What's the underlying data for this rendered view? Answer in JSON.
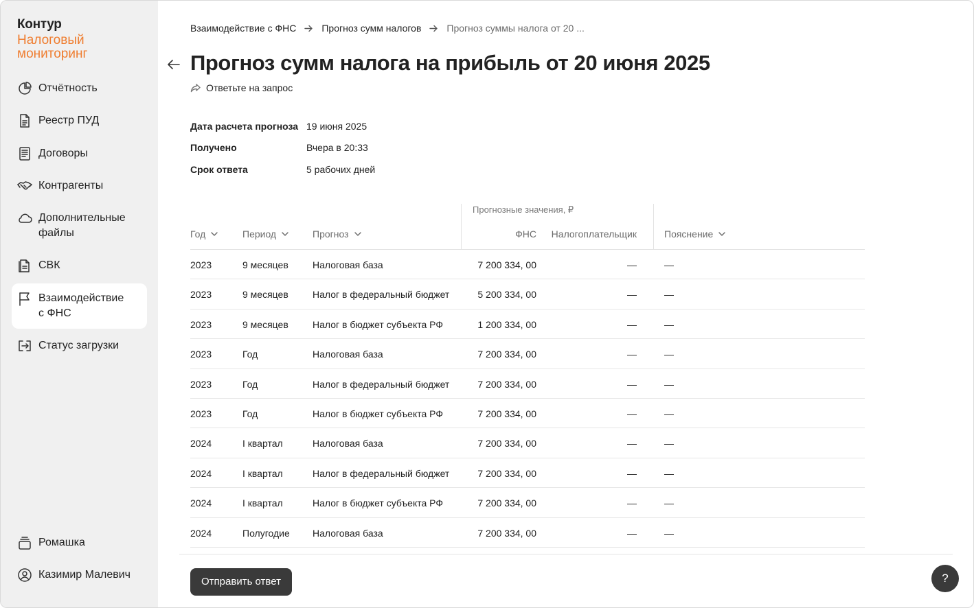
{
  "brand": {
    "name": "Контур",
    "product": "Налоговый\nмониторинг"
  },
  "sidebar": {
    "items": [
      {
        "label": "Отчётность",
        "icon": "pie-chart-icon"
      },
      {
        "label": "Реестр ПУД",
        "icon": "document-icon"
      },
      {
        "label": "Договоры",
        "icon": "contract-icon"
      },
      {
        "label": "Контрагенты",
        "icon": "handshake-icon"
      },
      {
        "label": "Дополнительные\nфайлы",
        "icon": "cloud-icon"
      },
      {
        "label": "СВК",
        "icon": "document-check-icon"
      },
      {
        "label": "Взаимодействие\nс ФНС",
        "icon": "flag-icon",
        "active": true
      },
      {
        "label": "Статус загрузки",
        "icon": "upload-status-icon"
      }
    ],
    "bottom": [
      {
        "label": "Ромашка",
        "icon": "organization-icon"
      },
      {
        "label": "Казимир Малевич",
        "icon": "user-icon"
      }
    ]
  },
  "breadcrumb": {
    "items": [
      "Взаимодействие с ФНС",
      "Прогноз сумм налогов",
      "Прогноз суммы налога от 20 ..."
    ]
  },
  "page": {
    "title": "Прогноз сумм налога на прибыль от 20 июня 2025",
    "reply_link": "Ответьте на запрос"
  },
  "meta": [
    {
      "key": "Дата расчета прогноза",
      "value": "19 июня 2025"
    },
    {
      "key": "Получено",
      "value": "Вчера в 20:33"
    },
    {
      "key": "Срок ответа",
      "value": "5 рабочих дней"
    }
  ],
  "table": {
    "group_label": "Прогнозные значения, ₽",
    "headers": {
      "year": "Год",
      "period": "Период",
      "forecast": "Прогноз",
      "fns": "ФНС",
      "payer": "Налогоплательщик",
      "explanation": "Пояснение"
    },
    "rows": [
      {
        "year": "2023",
        "period": "9 месяцев",
        "forecast": "Налоговая база",
        "fns": "7 200 334, 00",
        "payer": "—",
        "explanation": "—"
      },
      {
        "year": "2023",
        "period": "9 месяцев",
        "forecast": "Налог в федеральный бюджет",
        "fns": "5 200 334, 00",
        "payer": "—",
        "explanation": "—"
      },
      {
        "year": "2023",
        "period": "9 месяцев",
        "forecast": "Налог в бюджет субъекта РФ",
        "fns": "1 200 334, 00",
        "payer": "—",
        "explanation": "—"
      },
      {
        "year": "2023",
        "period": "Год",
        "forecast": "Налоговая база",
        "fns": "7 200 334, 00",
        "payer": "—",
        "explanation": "—"
      },
      {
        "year": "2023",
        "period": "Год",
        "forecast": "Налог в федеральный бюджет",
        "fns": "7 200 334, 00",
        "payer": "—",
        "explanation": "—"
      },
      {
        "year": "2023",
        "period": "Год",
        "forecast": "Налог в бюджет субъекта РФ",
        "fns": "7 200 334, 00",
        "payer": "—",
        "explanation": "—"
      },
      {
        "year": "2024",
        "period": "I квартал",
        "forecast": "Налоговая база",
        "fns": "7 200 334, 00",
        "payer": "—",
        "explanation": "—"
      },
      {
        "year": "2024",
        "period": "I квартал",
        "forecast": "Налог в федеральный бюджет",
        "fns": "7 200 334, 00",
        "payer": "—",
        "explanation": "—"
      },
      {
        "year": "2024",
        "period": "I квартал",
        "forecast": "Налог в бюджет субъекта РФ",
        "fns": "7 200 334, 00",
        "payer": "—",
        "explanation": "—"
      },
      {
        "year": "2024",
        "period": "Полугодие",
        "forecast": "Налоговая база",
        "fns": "7 200 334, 00",
        "payer": "—",
        "explanation": "—"
      }
    ]
  },
  "actions": {
    "send": "Отправить ответ",
    "help": "?"
  },
  "colors": {
    "accent": "#ef7d2f",
    "sidebar_bg": "#f0f0f0",
    "button_dark": "#3a3a3a"
  }
}
